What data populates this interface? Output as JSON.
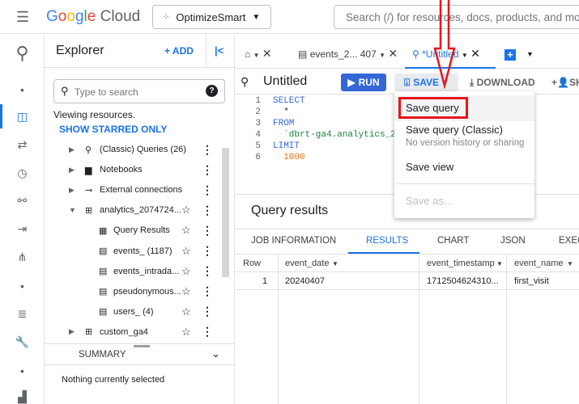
{
  "topbar": {
    "menu_icon": "hamburger-icon",
    "logo": "Google Cloud",
    "project": "OptimizeSmart",
    "search_placeholder": "Search (/) for resources, docs, products, and more"
  },
  "rail": {
    "icons": [
      "bigquery-logo-icon",
      "dot-icon",
      "explorer-icon",
      "transfers-icon",
      "scheduled-queries-icon",
      "analytics-hub-icon",
      "dataform-icon",
      "graph-icon",
      "dot-icon",
      "list-icon",
      "wrench-icon",
      "dot-icon",
      "chart-icon"
    ]
  },
  "explorer": {
    "title": "Explorer",
    "add_label": "+ ADD",
    "collapse": "|<",
    "search_placeholder": "Type to search",
    "viewing": "Viewing resources.",
    "show_starred": "SHOW STARRED ONLY",
    "items": [
      {
        "label": "(Classic) Queries (26)",
        "icon": "query-icon",
        "expand": "collapsed",
        "starrable": false
      },
      {
        "label": "Notebooks",
        "icon": "notebook-icon",
        "expand": "collapsed",
        "starrable": false
      },
      {
        "label": "External connections",
        "icon": "connection-icon",
        "expand": "collapsed",
        "starrable": false
      },
      {
        "label": "analytics_2074724...",
        "icon": "dataset-icon",
        "expand": "expanded",
        "starrable": true
      },
      {
        "label": "Query Results",
        "icon": "table-icon",
        "expand": "none",
        "starrable": true,
        "child": true
      },
      {
        "label": "events_ (1187)",
        "icon": "sharded-table-icon",
        "expand": "none",
        "starrable": true,
        "child": true
      },
      {
        "label": "events_intrada...",
        "icon": "sharded-table-icon",
        "expand": "none",
        "starrable": true,
        "child": true
      },
      {
        "label": "pseudonymous...",
        "icon": "sharded-table-icon",
        "expand": "none",
        "starrable": true,
        "child": true
      },
      {
        "label": "users_ (4)",
        "icon": "sharded-table-icon",
        "expand": "none",
        "starrable": true,
        "child": true
      },
      {
        "label": "custom_ga4",
        "icon": "dataset-icon",
        "expand": "collapsed",
        "starrable": true
      }
    ],
    "summary_title": "SUMMARY",
    "summary_text": "Nothing currently selected"
  },
  "tabs": [
    {
      "label": "",
      "icon": "home-icon"
    },
    {
      "label": "events_2... 407",
      "icon": "table-icon"
    },
    {
      "label": "*Untitled",
      "icon": "query-icon",
      "active": true
    }
  ],
  "toolbar": {
    "title": "Untitled",
    "run": "RUN",
    "save": "SAVE",
    "download": "DOWNLOAD",
    "share": "SH"
  },
  "editor": {
    "lines": [
      {
        "n": "1",
        "text": "SELECT",
        "color": "#3367d6"
      },
      {
        "n": "2",
        "text": "  *",
        "color": "#202124"
      },
      {
        "n": "3",
        "text": "FROM",
        "color": "#3367d6"
      },
      {
        "n": "4",
        "text": "  `dbrt-ga4.analytics_20",
        "color": "#188038"
      },
      {
        "n": "5",
        "text": "LIMIT",
        "color": "#3367d6"
      },
      {
        "n": "6",
        "text": "  1000",
        "color": "#e8710a"
      }
    ]
  },
  "save_menu": {
    "items": [
      "Save query",
      "Save query (Classic)",
      "Save view",
      "Save as..."
    ],
    "classic_sub": "No version history or sharing"
  },
  "results": {
    "title": "Query results",
    "tabs": [
      "JOB INFORMATION",
      "RESULTS",
      "CHART",
      "JSON",
      "EXEC"
    ],
    "active_tab": "RESULTS",
    "columns": [
      "Row",
      "event_date",
      "event_timestamp",
      "event_name"
    ],
    "rows": [
      [
        "1",
        "20240407",
        "1712504624310...",
        "first_visit"
      ]
    ]
  },
  "colors": {
    "accent": "#1a73e8",
    "run": "#3367d6",
    "highlight": "#e8141a"
  }
}
